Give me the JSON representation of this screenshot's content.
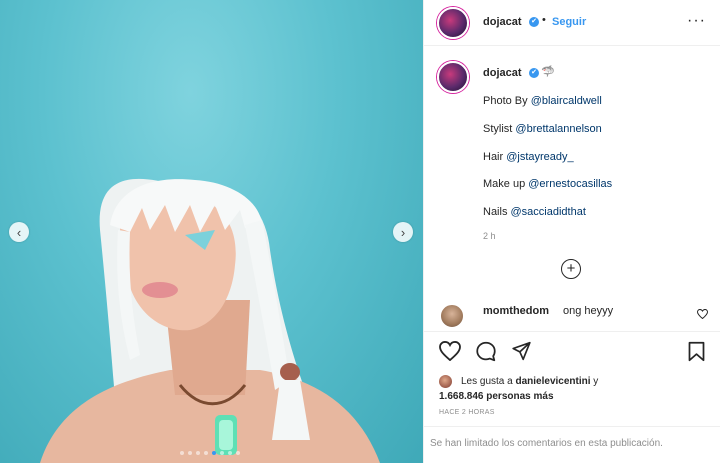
{
  "post": {
    "author": "dojacat",
    "follow_label": "Seguir",
    "separator": "•",
    "more_label": "···",
    "verified_glyph": "✔"
  },
  "caption": {
    "author": "dojacat",
    "emoji": "🦈",
    "lines": [
      {
        "prefix": "Photo By ",
        "mention": "@blaircaldwell"
      },
      {
        "prefix": "Stylist ",
        "mention": "@brettalannelson"
      },
      {
        "prefix": "Hair ",
        "mention": "@jstayready_"
      },
      {
        "prefix": "Make up ",
        "mention": "@ernestocasillas"
      },
      {
        "prefix": "Nails ",
        "mention": "@sacciadidthat"
      }
    ],
    "time": "2 h"
  },
  "add_comment_label": "+",
  "comment": {
    "author": "momthedom",
    "text": "ong heyyy"
  },
  "icons": [
    "heart-icon",
    "comment-icon",
    "share-icon",
    "bookmark-icon",
    "chevron-left-icon",
    "chevron-right-icon",
    "add-circle-icon"
  ],
  "likes": {
    "prefix": "Les gusta a ",
    "user": "danielevicentini",
    "suffix": " y",
    "count": "1.668.846 personas más"
  },
  "post_time": "HACE 2 HORAS",
  "comments_limited": "Se han limitado los comentarios en esta publicación.",
  "carousel": {
    "prev_label": "‹",
    "next_label": "›",
    "slide_count": 8,
    "active_index": 4
  },
  "colors": {
    "accent": "#3897f0",
    "background_photo": "#5cc1cf",
    "text": "#262626",
    "muted": "#8e8e8e"
  }
}
